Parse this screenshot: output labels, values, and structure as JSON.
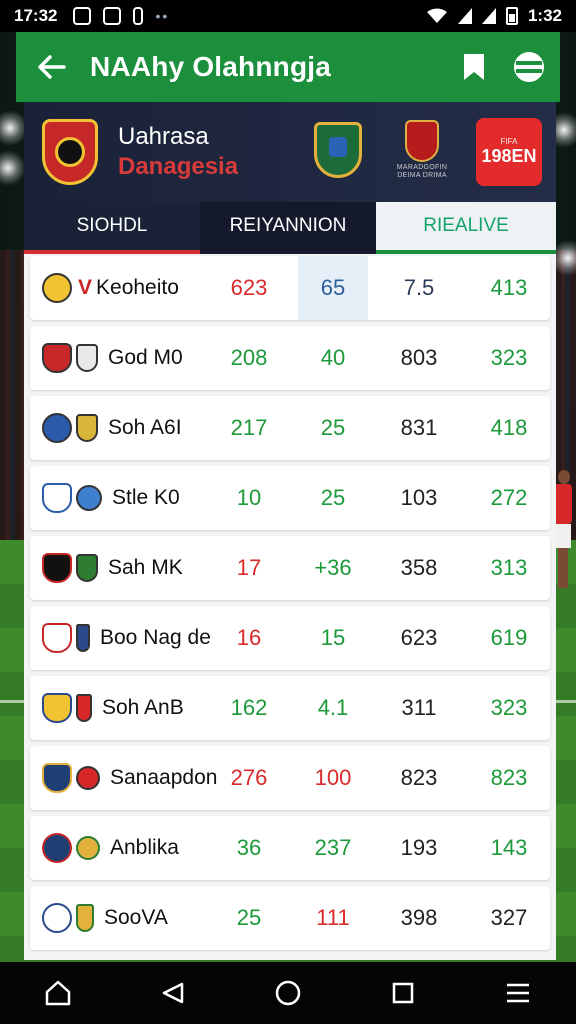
{
  "status_bar": {
    "time_left": "17:32",
    "time_right": "1:32"
  },
  "app_bar": {
    "title": "NAAhy Olahnngja",
    "icons": [
      "back-arrow-icon",
      "bookmark-icon",
      "globe-icon"
    ]
  },
  "match_header": {
    "team_line_1": "Uahrasa",
    "team_line_2": "Danagesia",
    "crest_caption": "MARADGOFIN DEIMA DRIMA",
    "score_badge_top": "FIFA",
    "score_badge_main": "198EN"
  },
  "tabs": [
    {
      "label": "SIOHDL"
    },
    {
      "label": "REIYANNION"
    },
    {
      "label": "RIEALIVE"
    }
  ],
  "rows": [
    {
      "team": "Keoheito",
      "v1": "623",
      "v2": "65",
      "v3": "7.5",
      "v4": "413"
    },
    {
      "team": "God M0",
      "v1": "208",
      "v2": "40",
      "v3": "803",
      "v4": "323"
    },
    {
      "team": "Soh A6I",
      "v1": "217",
      "v2": "25",
      "v3": "831",
      "v4": "418"
    },
    {
      "team": "Stle K0",
      "v1": "10",
      "v2": "25",
      "v3": "103",
      "v4": "272"
    },
    {
      "team": "Sah MK",
      "v1": "17",
      "v2": "+36",
      "v3": "358",
      "v4": "313"
    },
    {
      "team": "Boo Nag de",
      "v1": "16",
      "v2": "15",
      "v3": "623",
      "v4": "619"
    },
    {
      "team": "Soh AnB",
      "v1": "162",
      "v2": "4.1",
      "v3": "311",
      "v4": "323"
    },
    {
      "team": "Sanaapdon",
      "v1": "276",
      "v2": "100",
      "v3": "823",
      "v4": "823"
    },
    {
      "team": "Anblika",
      "v1": "36",
      "v2": "237",
      "v3": "193",
      "v4": "143"
    },
    {
      "team": "SooVA",
      "v1": "25",
      "v2": "111",
      "v3": "398",
      "v4": "327"
    }
  ],
  "nav_bar": {
    "icons": [
      "home-icon",
      "back-triangle-icon",
      "circle-home-icon",
      "recents-square-icon",
      "menu-icon"
    ]
  },
  "colors": {
    "app_bar": "#1b8f3c",
    "header_bg": "#1a2238",
    "accent_red": "#d32f2f",
    "value_green": "#1c9a3a",
    "value_red": "#d92b2b"
  }
}
